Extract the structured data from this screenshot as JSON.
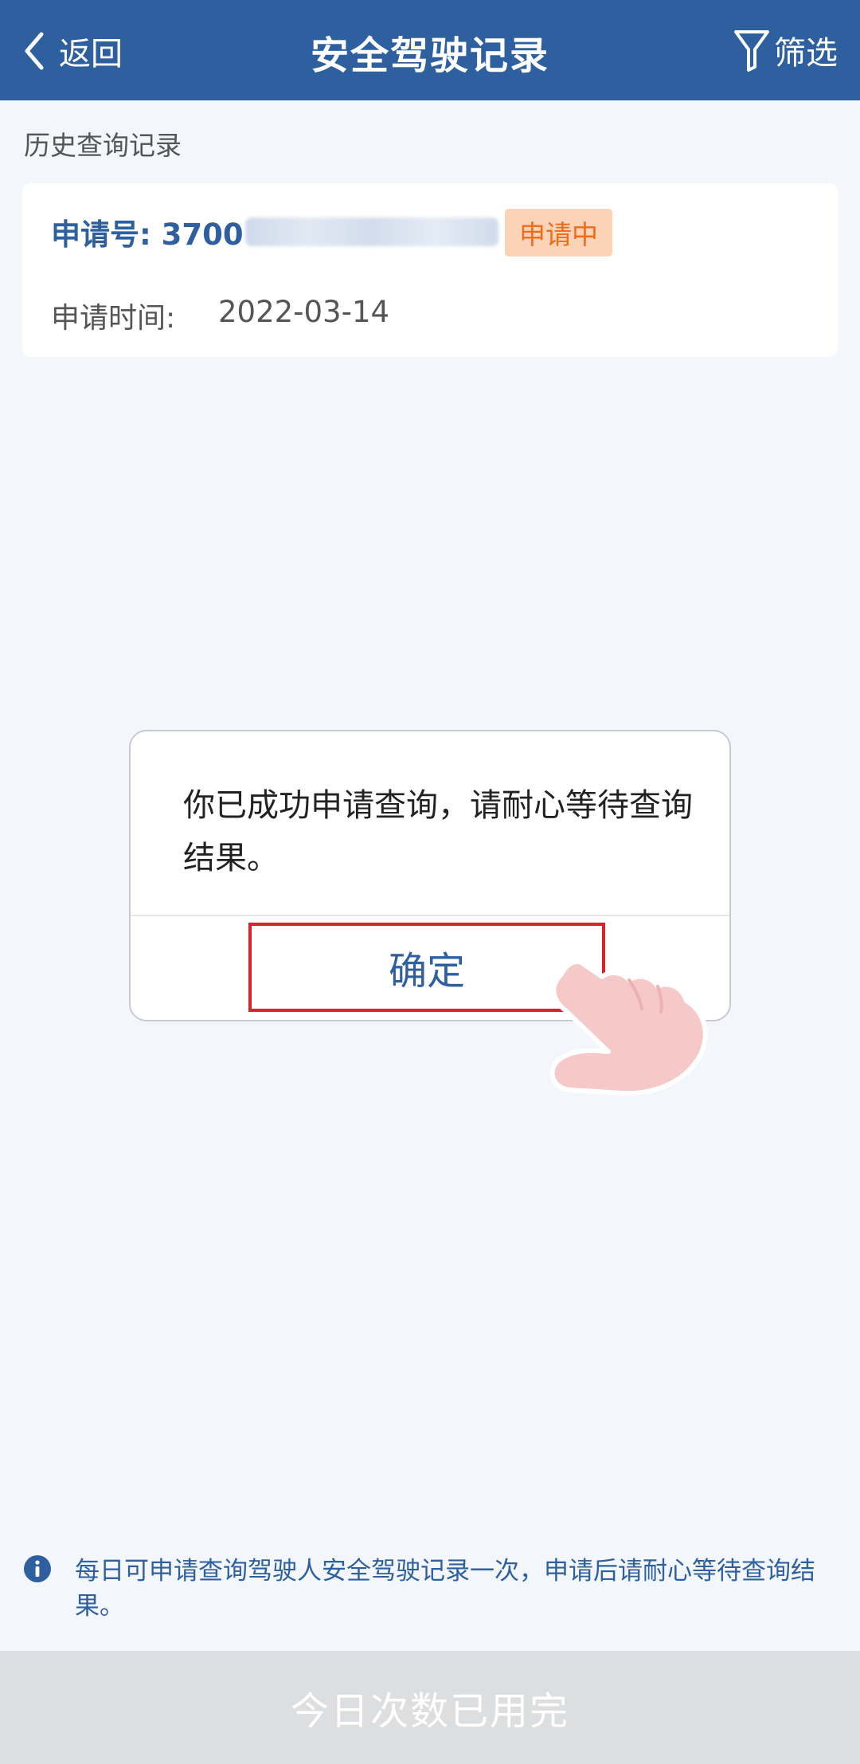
{
  "header": {
    "back_label": "返回",
    "title": "安全驾驶记录",
    "filter_label": "筛选",
    "bg_color": "#2e5f9e"
  },
  "history": {
    "section_label": "历史查询记录",
    "record": {
      "app_no_prefix": "申请号: 3700",
      "status": "申请中",
      "apply_time_label": "申请时间:",
      "apply_time_value": "2022-03-14"
    }
  },
  "dialog": {
    "message": "你已成功申请查询，请耐心等待查询结果。",
    "confirm_label": "确定"
  },
  "notice": {
    "icon": "info-icon",
    "text": "每日可申请查询驾驶人安全驾驶记录一次，申请后请耐心等待查询结果。"
  },
  "bottom": {
    "button_label": "今日次数已用完"
  },
  "colors": {
    "accent": "#2e5f9e",
    "status_orange": "#ef6b1c",
    "highlight_red": "#d9232b"
  }
}
